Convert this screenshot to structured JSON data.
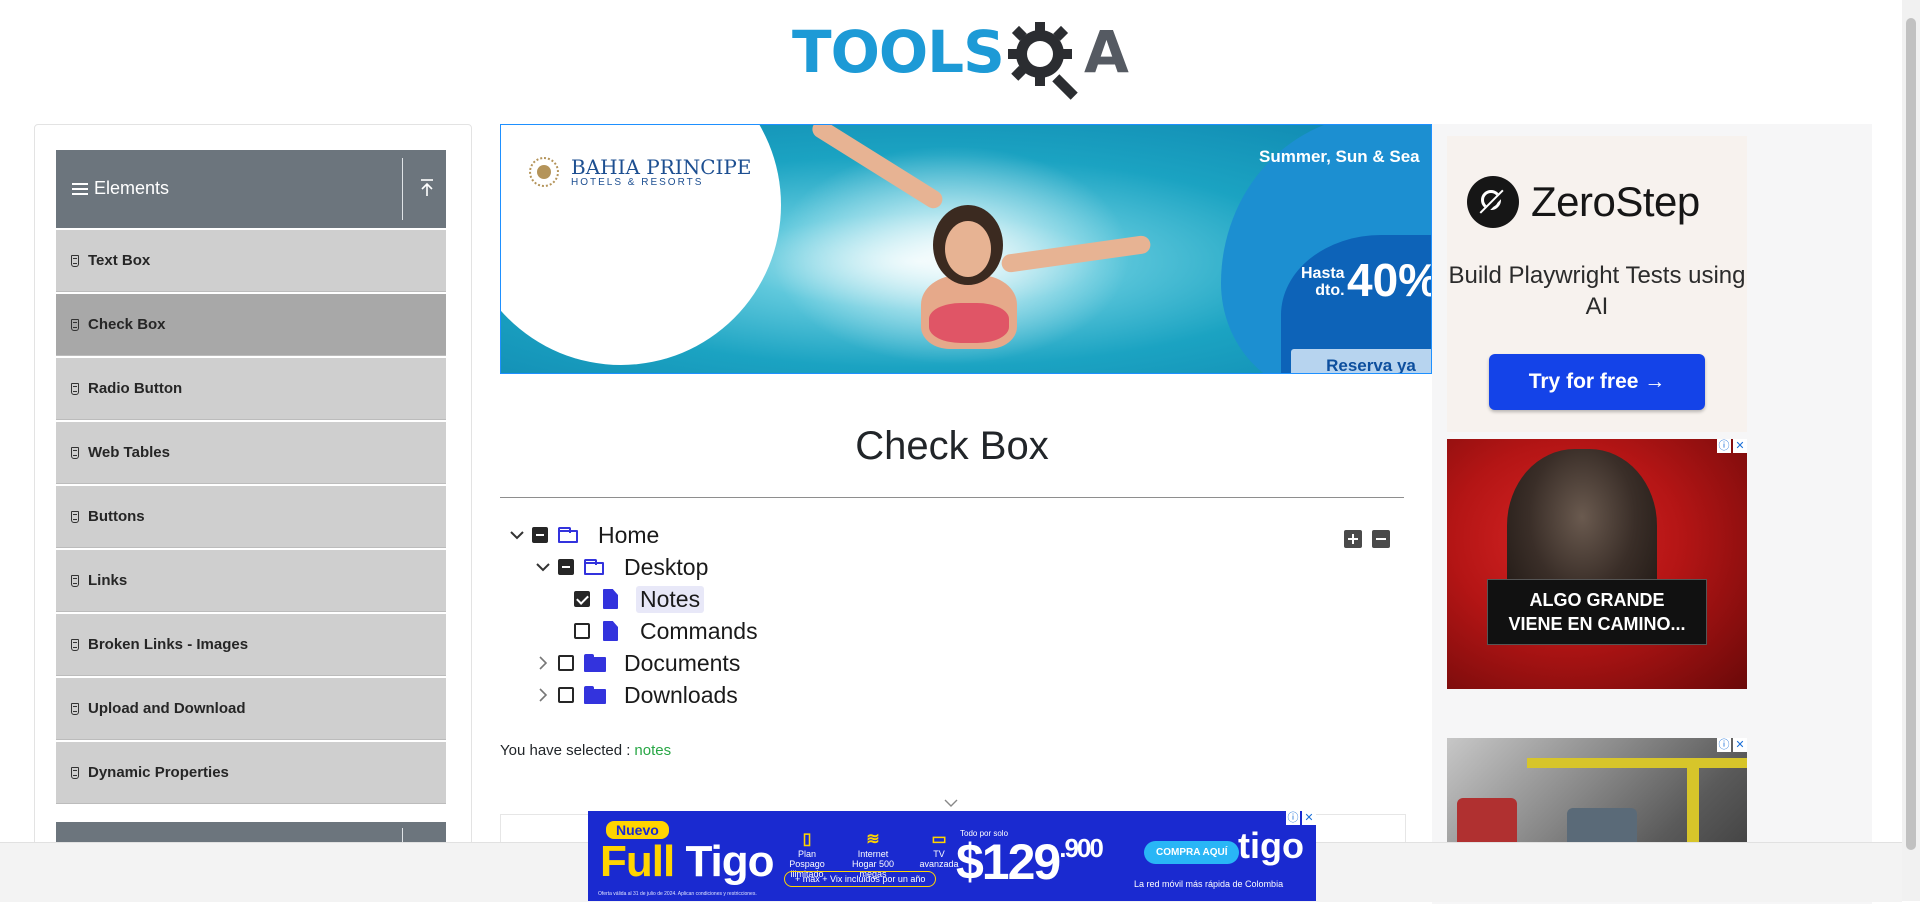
{
  "header": {
    "logo_left": "TOOLS",
    "logo_right": "A"
  },
  "sidebar": {
    "group_title": "Elements",
    "items": [
      {
        "label": "Text Box"
      },
      {
        "label": "Check Box",
        "active": true
      },
      {
        "label": "Radio Button"
      },
      {
        "label": "Web Tables"
      },
      {
        "label": "Buttons"
      },
      {
        "label": "Links"
      },
      {
        "label": "Broken Links - Images"
      },
      {
        "label": "Upload and Download"
      },
      {
        "label": "Dynamic Properties"
      }
    ]
  },
  "banner_ad": {
    "brand": "BAHIA PRINCIPE",
    "brand_sub": "HOTELS & RESORTS",
    "tagline": "Summer, Sun & Sea",
    "hasta_1": "Hasta",
    "hasta_2": "dto.",
    "discount": "40%",
    "cta": "Reserva ya"
  },
  "main": {
    "title": "Check Box",
    "tree": {
      "home": "Home",
      "desktop": "Desktop",
      "notes": "Notes",
      "commands": "Commands",
      "documents": "Documents",
      "downloads": "Downloads"
    },
    "result_label": "You have selected :",
    "result_value": "notes"
  },
  "right_ads": {
    "zerostep_name": "ZeroStep",
    "zerostep_tagline": "Build Playwright Tests using AI",
    "zerostep_cta": "Try for free →",
    "cod_line1": "ALGO GRANDE",
    "cod_line2": "VIENE EN CAMINO..."
  },
  "bottom_ad": {
    "nuevo": "Nuevo",
    "full": "Full",
    "tigo_plus": "Tigo",
    "feat1_icon": "▯",
    "feat1": "Plan Pospago ilimitado",
    "feat2_icon": "≋",
    "feat2": "Internet Hogar 500 megas",
    "feat3_icon": "▭",
    "feat3": "TV avanzada",
    "pill": "+ max + Vix incluidos por un año",
    "price_label": "Todo por solo",
    "price_main": "$129",
    "price_cents": ".900",
    "buy": "COMPRA AQUÍ",
    "brand": "tigo",
    "slogan": "La red móvil más rápida de Colombia",
    "legal": "Oferta válida al 31 de julio de 2024. Aplican condiciones y restricciones."
  },
  "colors": {
    "accent_blue": "#1d9ad6",
    "sidebar_header": "#6c757d",
    "folder_blue": "#3333dd",
    "result_green": "#28a745"
  }
}
